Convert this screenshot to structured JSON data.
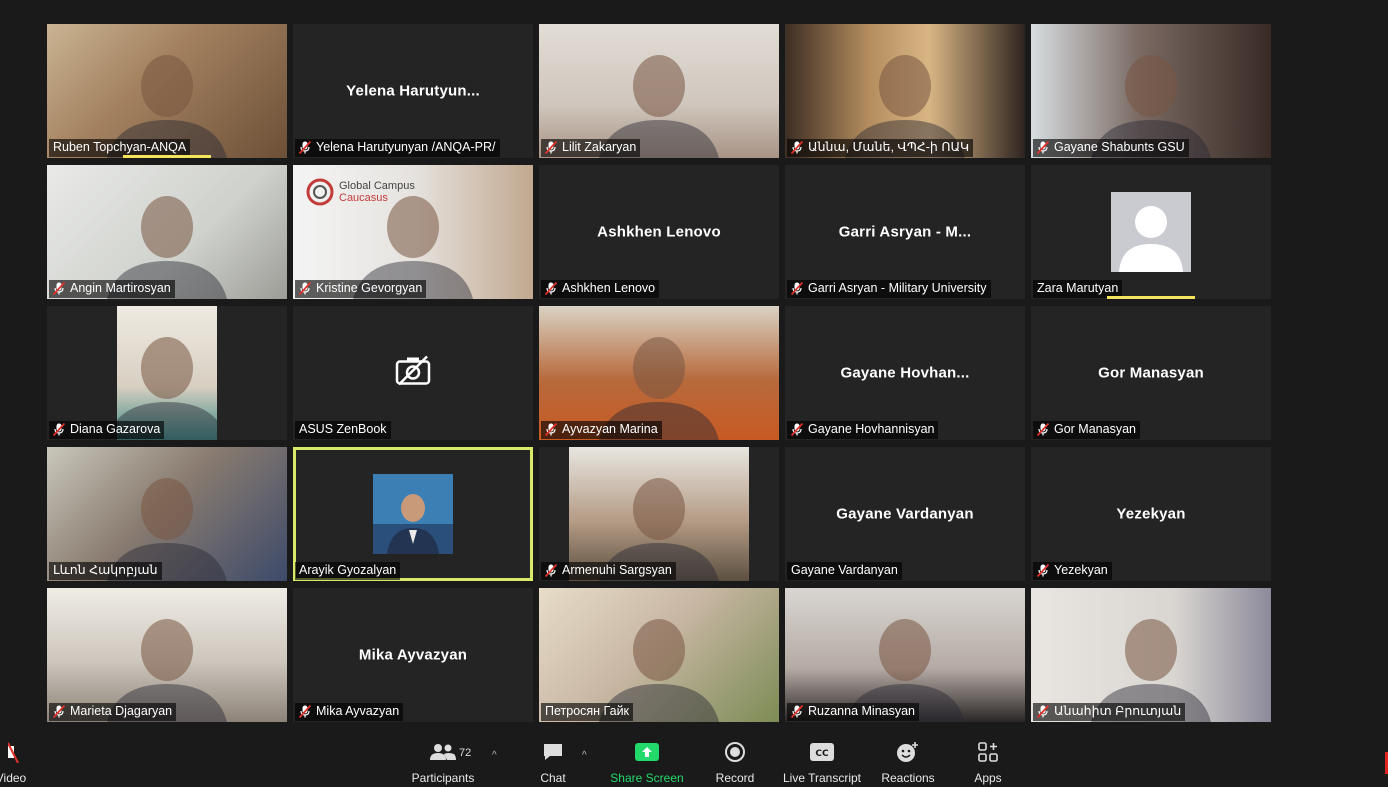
{
  "participants": [
    {
      "label": "Ruben Topchyan-ANQA",
      "muted": false,
      "video": "cam-warm",
      "speaking": true
    },
    {
      "label": "Yelena Harutyunyan /ANQA-PR/",
      "center": "Yelena  Harutyun...",
      "muted": true
    },
    {
      "label": "Lilit Zakaryan",
      "muted": true,
      "video": "cam-light"
    },
    {
      "label": "Աննա, Մանե, ՎՊՀ-ի ՈԱԿ",
      "muted": true,
      "video": "cam-wood"
    },
    {
      "label": "Gayane Shabunts GSU",
      "muted": true,
      "video": "cam-dark"
    },
    {
      "label": "Angin Martirosyan",
      "muted": true,
      "video": "cam-grey"
    },
    {
      "label": "Kristine Gevorgyan",
      "muted": true,
      "video": "cam-office",
      "overlay": "Global Campus",
      "overlay2": "Caucasus"
    },
    {
      "label": "Ashkhen Lenovo",
      "center": "Ashkhen Lenovo",
      "muted": true
    },
    {
      "label": "Garri Asryan - Military University",
      "center": "Garri Asryan - M...",
      "muted": true
    },
    {
      "label": "Zara Marutyan",
      "muted": false,
      "avatar": true,
      "speaking": true
    },
    {
      "label": "Diana Gazarova",
      "muted": true,
      "video": "cam-portrait"
    },
    {
      "label": "ASUS ZenBook",
      "muted": false,
      "camoff": true
    },
    {
      "label": "Ayvazyan Marina",
      "muted": true,
      "video": "cam-orange"
    },
    {
      "label": "Gayane Hovhannisyan",
      "center": "Gayane  Hovhan...",
      "muted": true
    },
    {
      "label": "Gor Manasyan",
      "center": "Gor Manasyan",
      "muted": true
    },
    {
      "label": "Լևոն Հակոբյան",
      "muted": false,
      "video": "cam-man"
    },
    {
      "label": "Arayik Gyozalyan",
      "muted": false,
      "photo": true,
      "active": true
    },
    {
      "label": "Armenuhi Sargsyan",
      "muted": true,
      "video": "cam-med"
    },
    {
      "label": "Gayane Vardanyan",
      "center": "Gayane Vardanyan",
      "muted": false
    },
    {
      "label": "Yezekyan",
      "center": "Yezekyan",
      "muted": true
    },
    {
      "label": "Marieta Djagaryan",
      "muted": true,
      "video": "cam-old"
    },
    {
      "label": "Mika Ayvazyan",
      "center": "Mika Ayvazyan",
      "muted": true
    },
    {
      "label": "Петросян Гайк",
      "muted": false,
      "video": "cam-room"
    },
    {
      "label": "Ruzanna Minasyan",
      "muted": true,
      "video": "cam-wall"
    },
    {
      "label": "Անահիտ Բրուտյան",
      "muted": true,
      "video": "cam-shelf"
    }
  ],
  "toolbar": {
    "video_label": "Video",
    "participants_label": "Participants",
    "participants_count": "72",
    "chat_label": "Chat",
    "share_label": "Share Screen",
    "record_label": "Record",
    "transcript_label": "Live Transcript",
    "reactions_label": "Reactions",
    "apps_label": "Apps"
  },
  "colors": {
    "share_green": "#23d96b",
    "active_border": "#d9e96a",
    "speaking_bar": "#f3e35d",
    "mute_red": "#e0312b"
  }
}
